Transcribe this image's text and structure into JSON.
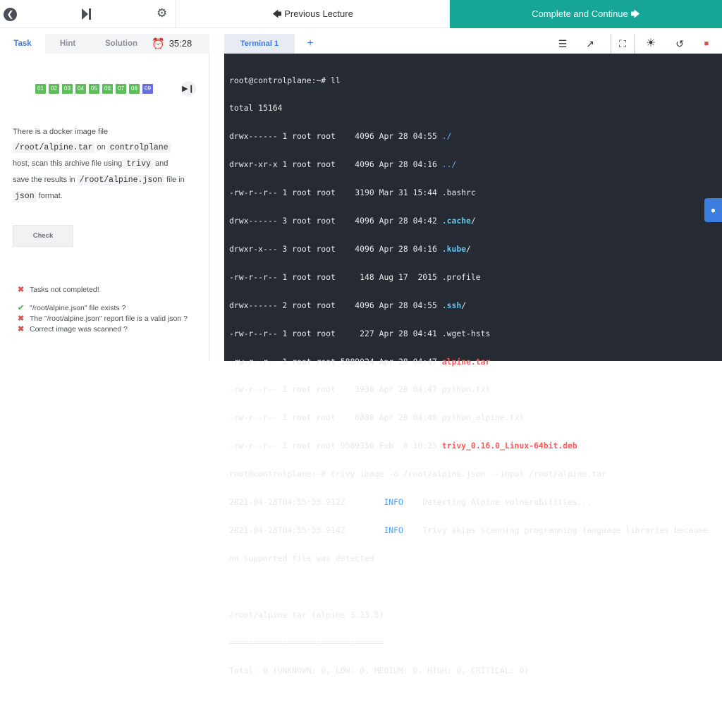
{
  "topbar": {
    "back_icon": "chevron-left-icon",
    "skip_icon": "skip-end-icon",
    "settings_icon": "gear-icon",
    "prev_label": "Previous Lecture",
    "complete_label": "Complete and Continue"
  },
  "left": {
    "tabs": [
      {
        "label": "Task"
      },
      {
        "label": "Hint"
      },
      {
        "label": "Solution"
      }
    ],
    "timer": "35:28",
    "questions": [
      "01",
      "02",
      "03",
      "04",
      "05",
      "06",
      "07",
      "08",
      "09"
    ],
    "current_question": "09",
    "task": {
      "p1": "There is a docker image file",
      "file": "/root/alpine.tar",
      "on": "on",
      "host_name": "controlplane",
      "p2": "host, scan this archive file using",
      "tool": "trivy",
      "and": "and",
      "p3": "save the results in",
      "results_file": "/root/alpine.json",
      "file_in": "file in",
      "format": "json",
      "format_word": "format."
    },
    "check_label": "Check",
    "results": [
      {
        "status": "fail",
        "text": "Tasks not completed!"
      },
      {
        "status": "pass",
        "text": "\"/root/alpine.json\" file exists ?"
      },
      {
        "status": "fail",
        "text": "The \"/root/alpine.json\" report file is a valid json ?"
      },
      {
        "status": "fail",
        "text": "Correct image was scanned ?"
      }
    ]
  },
  "terminal": {
    "tab_label": "Terminal 1",
    "add_label": "+",
    "tools": [
      "menu-icon",
      "external-link-icon",
      "fullscreen-icon",
      "brightness-icon",
      "history-icon",
      "stop-icon"
    ],
    "prompt": "root@controlplane:~#",
    "cmd1": "ll",
    "total": "total 15164",
    "listing": [
      {
        "meta": "drwx------ 1 root root    4096 Apr 28 04:55 ",
        "name": "./",
        "style": "blue"
      },
      {
        "meta": "drwxr-xr-x 1 root root    4096 Apr 28 04:16 ",
        "name": "../",
        "style": "blue"
      },
      {
        "meta": "-rw-r--r-- 1 root root    3190 Mar 31 15:44 ",
        "name": ".bashrc",
        "style": ""
      },
      {
        "meta": "drwx------ 3 root root    4096 Apr 28 04:42 ",
        "name": ".cache",
        "style": "cyanb",
        "suffix": "/"
      },
      {
        "meta": "drwxr-x--- 3 root root    4096 Apr 28 04:16 ",
        "name": ".kube",
        "style": "cyanb",
        "suffix": "/"
      },
      {
        "meta": "-rw-r--r-- 1 root root     148 Aug 17  2015 ",
        "name": ".profile",
        "style": ""
      },
      {
        "meta": "drwx------ 2 root root    4096 Apr 28 04:55 ",
        "name": ".ssh",
        "style": "cyanb",
        "suffix": "/"
      },
      {
        "meta": "-rw-r--r-- 1 root root     227 Apr 28 04:41 ",
        "name": ".wget-hsts",
        "style": ""
      },
      {
        "meta": "-rw-r--r-- 1 root root 5889024 Apr 28 04:47 ",
        "name": "alpine.tar",
        "style": "redb"
      },
      {
        "meta": "-rw-r--r-- 1 root root    3936 Apr 28 04:47 ",
        "name": "python.txt",
        "style": ""
      },
      {
        "meta": "-rw-r--r-- 1 root root    6888 Apr 28 04:46 ",
        "name": "python_alpine.txt",
        "style": ""
      },
      {
        "meta": "-rw-r--r-- 1 root root 9589356 Feb  8 10:25 ",
        "name": "trivy_0.16.0_Linux-64bit.deb",
        "style": "redb"
      }
    ],
    "cmd2": "trivy image -o /root/alpine.json --input /root/alpine.tar",
    "logs": [
      {
        "ts": "2021-04-28T04:55:55.912Z        ",
        "level": "INFO",
        "msg": "    Detecting Alpine vulnerabilities..."
      },
      {
        "ts": "2021-04-28T04:55:55.914Z        ",
        "level": "INFO",
        "msg": "    Trivy skips scanning programming language libraries because"
      }
    ],
    "log_cont": "no supported file was detected",
    "report_title": "/root/alpine.tar (alpine 3.13.5)",
    "report_rule": "================================",
    "report_total": "Total: 0 (UNKNOWN: 0, LOW: 0, MEDIUM: 0, HIGH: 0, CRITICAL: 0)"
  },
  "chat_icon": "chat-icon"
}
